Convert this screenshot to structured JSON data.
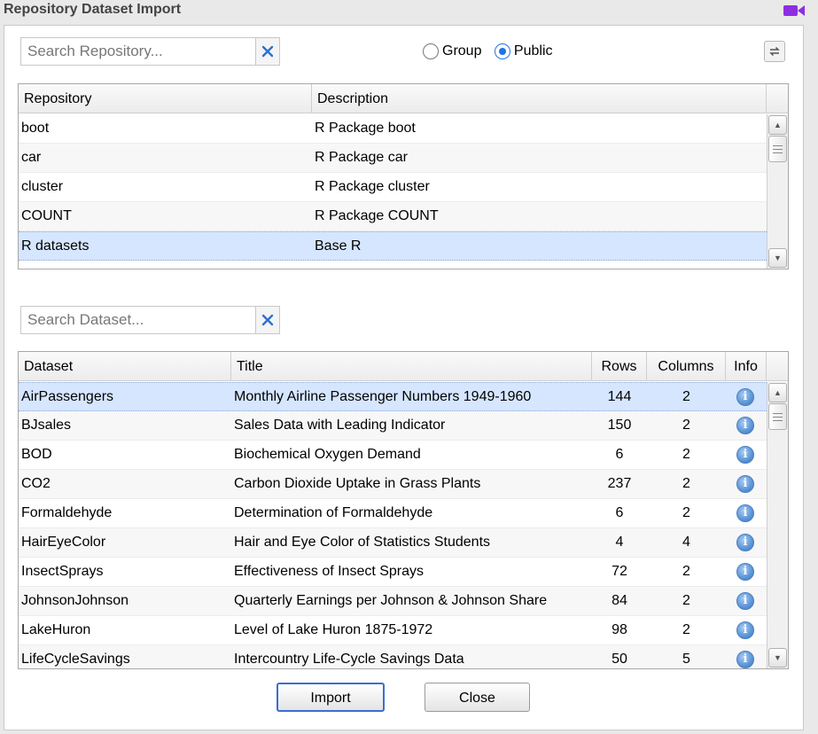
{
  "window": {
    "title": "Repository Dataset Import",
    "icon": "video-camera-icon",
    "icon_color": "#8e2de2"
  },
  "repo_search": {
    "placeholder": "Search Repository...",
    "value": ""
  },
  "scope": {
    "options": [
      "Group",
      "Public"
    ],
    "selected": "Public"
  },
  "repo_grid": {
    "columns": [
      "Repository",
      "Description"
    ],
    "rows": [
      {
        "repository": "boot",
        "description": "R Package boot"
      },
      {
        "repository": "car",
        "description": "R Package car"
      },
      {
        "repository": "cluster",
        "description": "R Package cluster"
      },
      {
        "repository": "COUNT",
        "description": "R Package COUNT"
      },
      {
        "repository": "R datasets",
        "description": "Base R",
        "selected": true
      }
    ]
  },
  "dataset_search": {
    "placeholder": "Search Dataset...",
    "value": ""
  },
  "dataset_grid": {
    "columns": [
      "Dataset",
      "Title",
      "Rows",
      "Columns",
      "Info"
    ],
    "rows": [
      {
        "dataset": "AirPassengers",
        "title": "Monthly Airline Passenger Numbers 1949-1960",
        "rows": "144",
        "columns": "2",
        "selected": true
      },
      {
        "dataset": "BJsales",
        "title": "Sales Data with Leading Indicator",
        "rows": "150",
        "columns": "2"
      },
      {
        "dataset": "BOD",
        "title": "Biochemical Oxygen Demand",
        "rows": "6",
        "columns": "2"
      },
      {
        "dataset": "CO2",
        "title": "Carbon Dioxide Uptake in Grass Plants",
        "rows": "237",
        "columns": "2"
      },
      {
        "dataset": "Formaldehyde",
        "title": "Determination of Formaldehyde",
        "rows": "6",
        "columns": "2"
      },
      {
        "dataset": "HairEyeColor",
        "title": "Hair and Eye Color of Statistics Students",
        "rows": "4",
        "columns": "4"
      },
      {
        "dataset": "InsectSprays",
        "title": "Effectiveness of Insect Sprays",
        "rows": "72",
        "columns": "2"
      },
      {
        "dataset": "JohnsonJohnson",
        "title": "Quarterly Earnings per Johnson & Johnson Share",
        "rows": "84",
        "columns": "2"
      },
      {
        "dataset": "LakeHuron",
        "title": "Level of Lake Huron 1875-1972",
        "rows": "98",
        "columns": "2"
      },
      {
        "dataset": "LifeCycleSavings",
        "title": "Intercountry Life-Cycle Savings Data",
        "rows": "50",
        "columns": "5"
      }
    ],
    "info_icon": "info-icon"
  },
  "buttons": {
    "import": "Import",
    "close": "Close"
  },
  "colors": {
    "accent": "#1f74e8",
    "selected_row": "#d6e6ff",
    "clear_x": "#2f6fd0"
  }
}
